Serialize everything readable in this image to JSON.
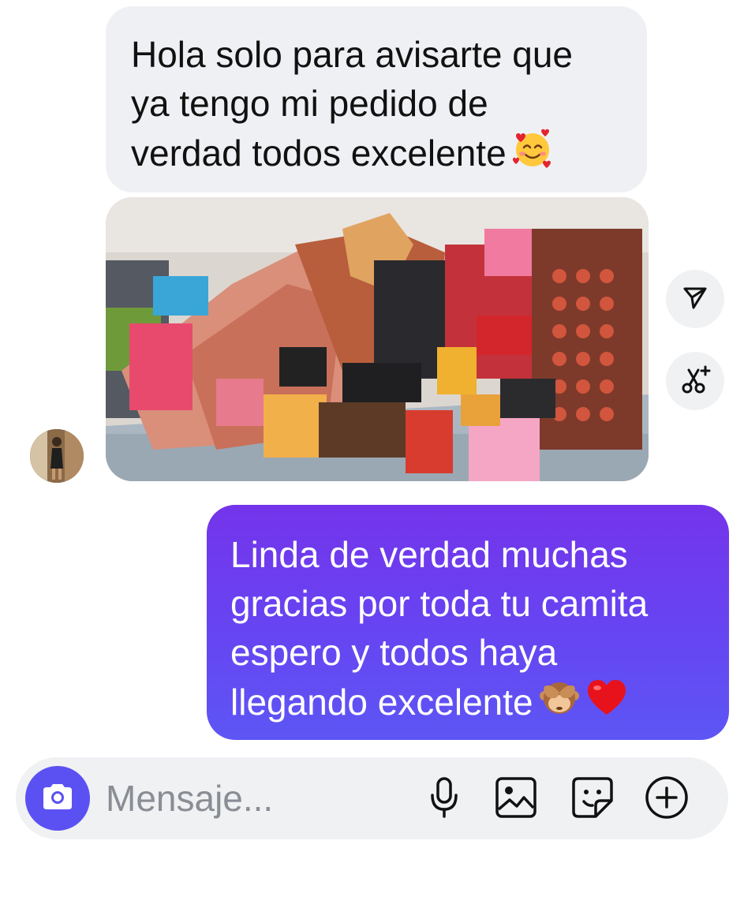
{
  "messages": {
    "incoming_text": "Hola solo para avisarte que\nya tengo mi pedido de\nverdad todos excelente",
    "incoming_emoji": "smiling-face-with-hearts",
    "photo_icon": "makeup-products-photo",
    "outgoing_text": "Linda de  verdad muchas\ngracias por toda tu camita\nespero y todos haya\nllegando excelente",
    "outgoing_emojis": [
      "see-no-evil-monkey",
      "red-heart"
    ]
  },
  "side_actions": {
    "share_icon": "send-icon",
    "remix_icon": "remix-scissors-icon"
  },
  "composer": {
    "placeholder": "Mensaje...",
    "icons": [
      "camera-icon",
      "microphone-icon",
      "image-icon",
      "sticker-icon",
      "plus-circle-icon"
    ]
  },
  "colors": {
    "incoming_bubble": "#eff0f3",
    "outgoing_bubble_top": "#7434ea",
    "outgoing_bubble_bottom": "#5d56f4",
    "camera_button": "#5b51f3",
    "composer_bg": "#f0f1f3"
  }
}
